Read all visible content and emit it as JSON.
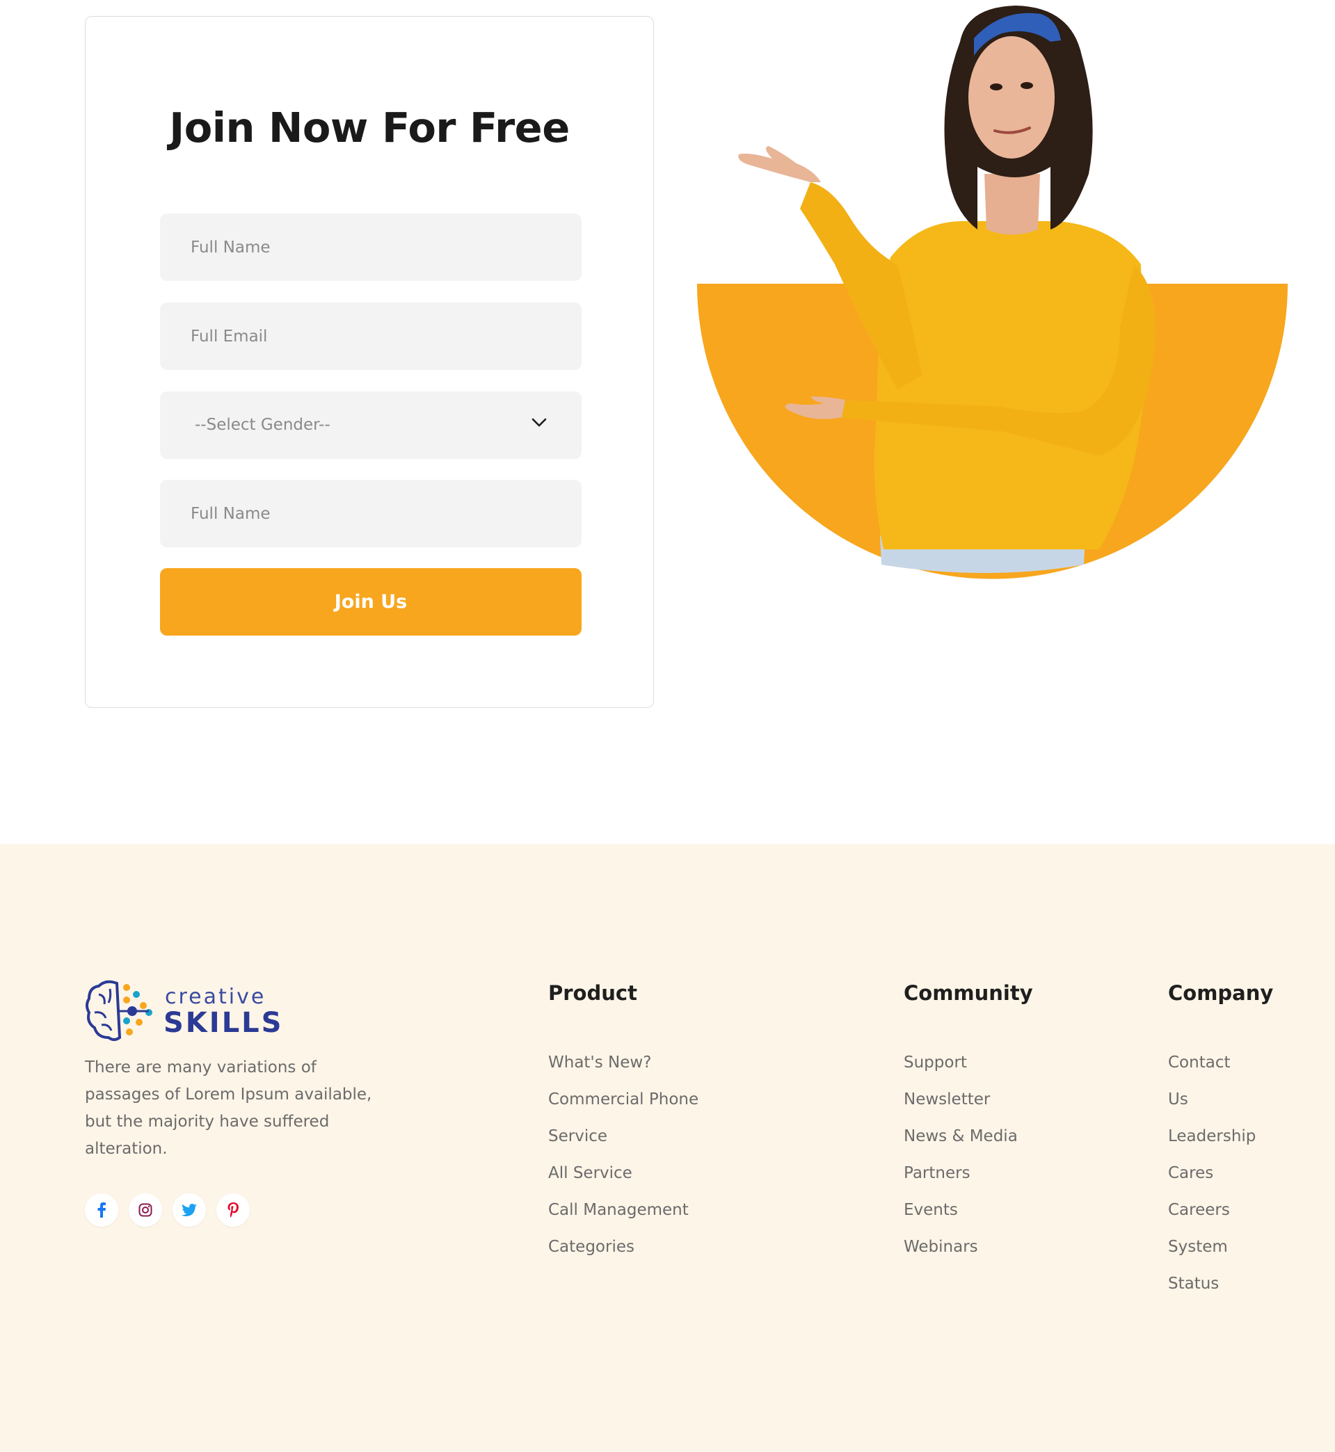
{
  "join_form": {
    "title": "Join Now For Free",
    "fields": [
      {
        "placeholder": "Full Name"
      },
      {
        "placeholder": "Full Email"
      },
      {
        "placeholder": "Full Name"
      }
    ],
    "gender_select": {
      "selected": "--Select Gender--"
    },
    "submit_label": "Join Us"
  },
  "colors": {
    "accent": "#f7a61e",
    "footer_bg": "#fdf5e8",
    "sweater": "#f5b818"
  },
  "brand": {
    "line1": "creative",
    "line2": "SKILLS",
    "description": "There are many variations of passages of Lorem Ipsum available, but the majority have suffered alteration."
  },
  "socials": [
    {
      "icon": "facebook-icon",
      "color": "#1877f2"
    },
    {
      "icon": "instagram-icon",
      "color": "#8a1b4e"
    },
    {
      "icon": "twitter-icon",
      "color": "#1da1f2"
    },
    {
      "icon": "pinterest-icon",
      "color": "#e60023"
    }
  ],
  "footer": {
    "product": {
      "title": "Product",
      "items": [
        "What's New?",
        "Commercial Phone",
        "Service",
        "All Service",
        "Call Management",
        "Categories"
      ]
    },
    "community": {
      "title": "Community",
      "items": [
        "Support",
        "Newsletter",
        "News & Media",
        "Partners",
        "Events",
        "Webinars"
      ]
    },
    "company": {
      "title": "Company",
      "items": [
        "Contact",
        "Us",
        "Leadership",
        "Cares",
        "Careers",
        "System",
        "Status"
      ]
    }
  }
}
